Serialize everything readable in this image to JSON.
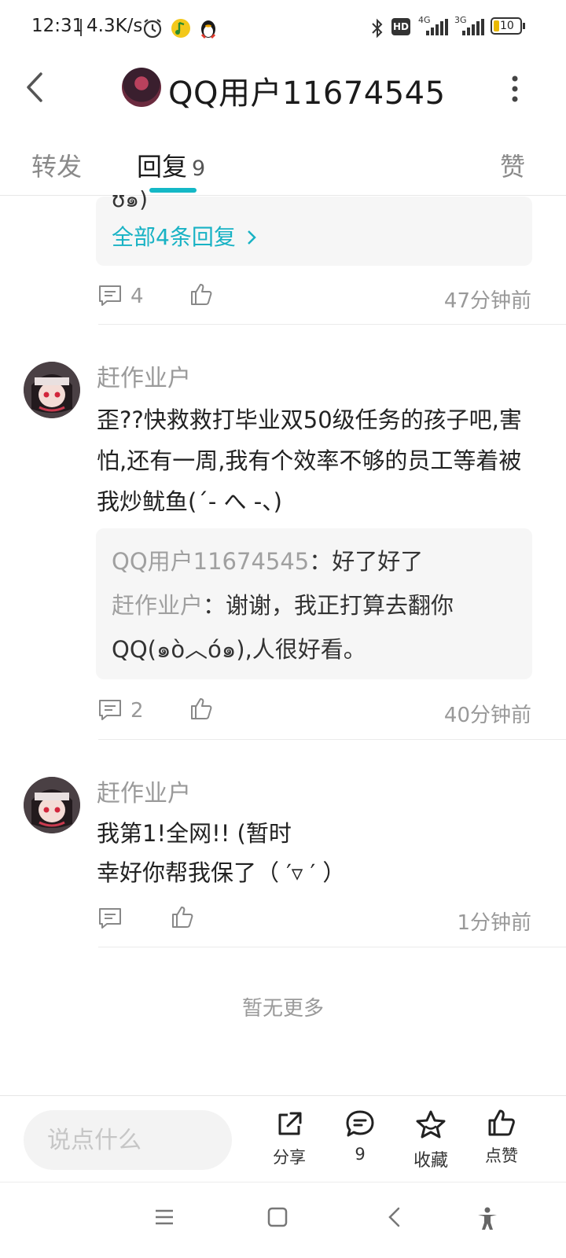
{
  "status_bar": {
    "time": "12:31",
    "speed": "4.3K/s",
    "hd": "HD",
    "net1": "4G",
    "net2": "3G",
    "battery": "10"
  },
  "header": {
    "title": "QQ用户11674545"
  },
  "tabs": [
    {
      "label": "转发"
    },
    {
      "label": "回复",
      "count": "9"
    },
    {
      "label": "赞"
    }
  ],
  "comments": [
    {
      "partial_reply_tail": "ʊ๑)",
      "all_replies": "全部4条回复",
      "reply_count": "4",
      "time": "47分钟前"
    },
    {
      "author": "赶作业户",
      "body": "歪??快救救打毕业双50级任务的孩子吧,害怕,还有一周,我有个效率不够的员工等着被我炒鱿鱼(ˊ- へ -、)",
      "replies": [
        {
          "name": "QQ用户11674545",
          "sep": "：",
          "text": "好了好了"
        },
        {
          "name": "赶作业户",
          "sep": "：",
          "text": "谢谢，我正打算去翻你QQ(๑ò︿ó๑),人很好看。"
        }
      ],
      "reply_count": "2",
      "time": "40分钟前"
    },
    {
      "author": "赶作业户",
      "body_line1": "我第1!全网!! (暂时",
      "body_line2": "幸好你帮我保了（ ′▿ ′ ）",
      "time": "1分钟前"
    }
  ],
  "footer_note": "暂无更多",
  "bottom_bar": {
    "input_placeholder": "说点什么",
    "share": "分享",
    "comment_count": "9",
    "favorite": "收藏",
    "like": "点赞"
  },
  "colors": {
    "accent": "#14b8c6",
    "link": "#18b2c4"
  }
}
